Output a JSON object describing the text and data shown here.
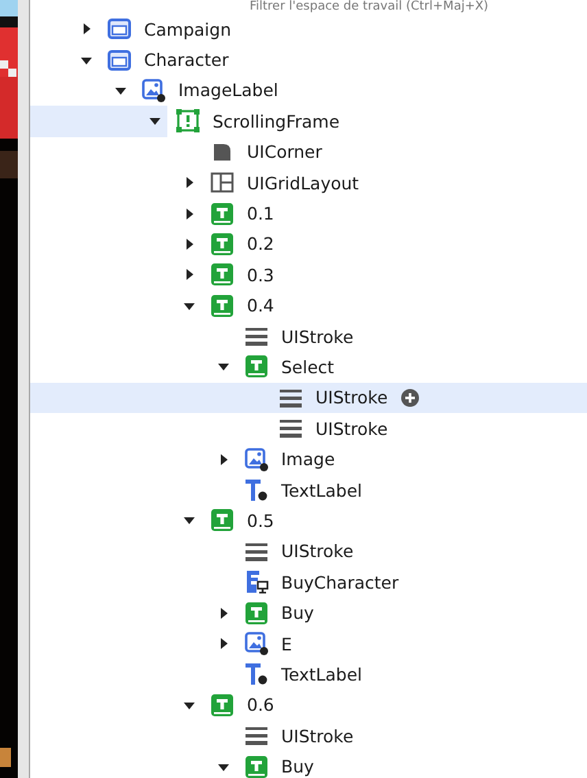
{
  "filter": {
    "placeholder": "Filtrer l'espace de travail (Ctrl+Maj+X)"
  },
  "tree": [
    {
      "name": "Campaign",
      "kind": "frame",
      "expanded": false,
      "selected": false,
      "hovered": false
    },
    {
      "name": "Character",
      "kind": "frame",
      "expanded": true,
      "selected": false,
      "hovered": false,
      "children": [
        {
          "name": "ImageLabel",
          "kind": "imagelabel",
          "expanded": true,
          "selected": false,
          "hovered": false,
          "children": [
            {
              "name": "ScrollingFrame",
              "kind": "scrollingframe",
              "expanded": true,
              "selected": false,
              "hovered": true,
              "children": [
                {
                  "name": "UICorner",
                  "kind": "corner",
                  "selected": false,
                  "hovered": false
                },
                {
                  "name": "UIGridLayout",
                  "kind": "gridlayout",
                  "expanded": false,
                  "selected": false,
                  "hovered": false
                },
                {
                  "name": "0.1",
                  "kind": "textbutton",
                  "expanded": false,
                  "selected": false,
                  "hovered": false
                },
                {
                  "name": "0.2",
                  "kind": "textbutton",
                  "expanded": false,
                  "selected": false,
                  "hovered": false
                },
                {
                  "name": "0.3",
                  "kind": "textbutton",
                  "expanded": false,
                  "selected": false,
                  "hovered": false
                },
                {
                  "name": "0.4",
                  "kind": "textbutton",
                  "expanded": true,
                  "selected": false,
                  "hovered": false,
                  "children": [
                    {
                      "name": "UIStroke",
                      "kind": "stroke",
                      "selected": false,
                      "hovered": false
                    },
                    {
                      "name": "Select",
                      "kind": "textbutton",
                      "expanded": true,
                      "selected": false,
                      "hovered": false,
                      "children": [
                        {
                          "name": "UIStroke",
                          "kind": "stroke",
                          "selected": true,
                          "hovered": false
                        },
                        {
                          "name": "UIStroke",
                          "kind": "stroke",
                          "selected": false,
                          "hovered": false
                        }
                      ]
                    },
                    {
                      "name": "Image",
                      "kind": "imagelabel",
                      "expanded": false,
                      "selected": false,
                      "hovered": false
                    },
                    {
                      "name": "TextLabel",
                      "kind": "textlabel",
                      "selected": false,
                      "hovered": false
                    }
                  ]
                },
                {
                  "name": "0.5",
                  "kind": "textbutton",
                  "expanded": true,
                  "selected": false,
                  "hovered": false,
                  "children": [
                    {
                      "name": "UIStroke",
                      "kind": "stroke",
                      "selected": false,
                      "hovered": false
                    },
                    {
                      "name": "BuyCharacter",
                      "kind": "localscript",
                      "selected": false,
                      "hovered": false
                    },
                    {
                      "name": "Buy",
                      "kind": "textbutton",
                      "expanded": false,
                      "selected": false,
                      "hovered": false
                    },
                    {
                      "name": "E",
                      "kind": "imagelabel",
                      "expanded": false,
                      "selected": false,
                      "hovered": false
                    },
                    {
                      "name": "TextLabel",
                      "kind": "textlabel",
                      "selected": false,
                      "hovered": false
                    }
                  ]
                },
                {
                  "name": "0.6",
                  "kind": "textbutton",
                  "expanded": true,
                  "selected": false,
                  "hovered": false,
                  "children": [
                    {
                      "name": "UIStroke",
                      "kind": "stroke",
                      "selected": false,
                      "hovered": false
                    },
                    {
                      "name": "Buy",
                      "kind": "textbutton",
                      "expanded": true,
                      "selected": false,
                      "hovered": false
                    }
                  ]
                }
              ]
            }
          ]
        }
      ]
    }
  ]
}
